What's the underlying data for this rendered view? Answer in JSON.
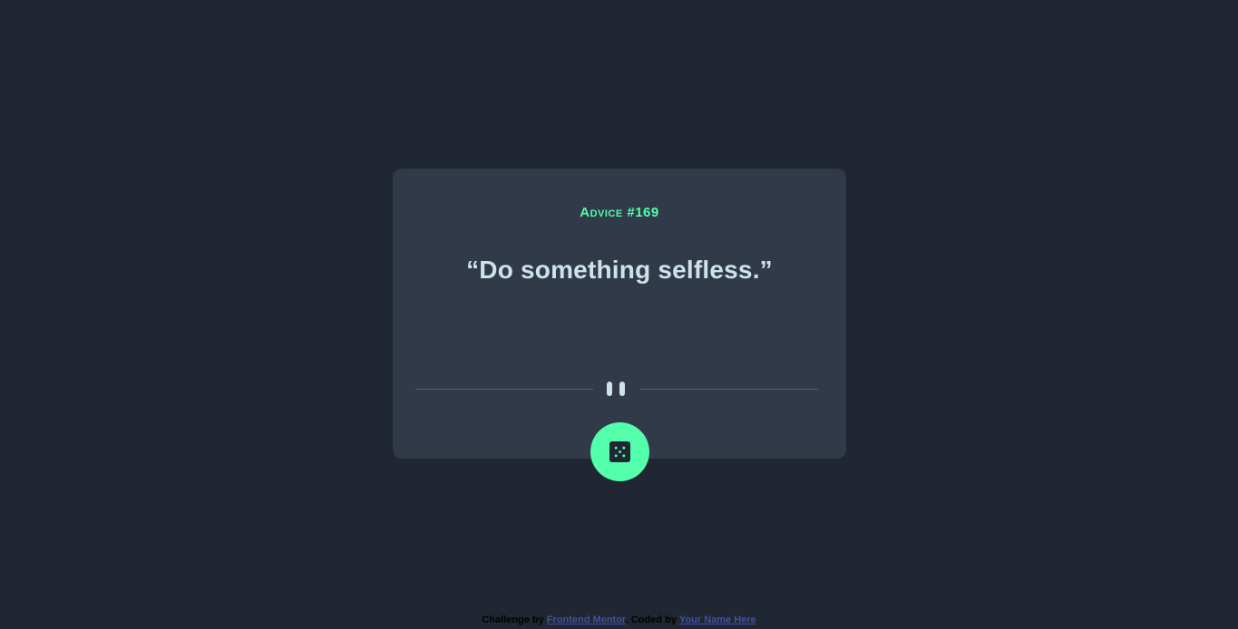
{
  "advice": {
    "label": "Advice",
    "number": "#169",
    "quote": "“Do something selfless.”"
  },
  "divider": {
    "icon": "pause-icon"
  },
  "dice_button": {
    "icon": "dice-icon"
  },
  "footer": {
    "challenge_prefix": "Challenge by",
    "challenge_link": "Frontend Mentor",
    "coded_prefix": ". Coded by",
    "coded_link": "Your Name Here"
  },
  "colors": {
    "background": "#202632",
    "card": "#313a48",
    "accent": "#53ffaa",
    "quote_text": "#cee3e9",
    "divider": "#4f5d74",
    "link": "#3e52a3"
  }
}
